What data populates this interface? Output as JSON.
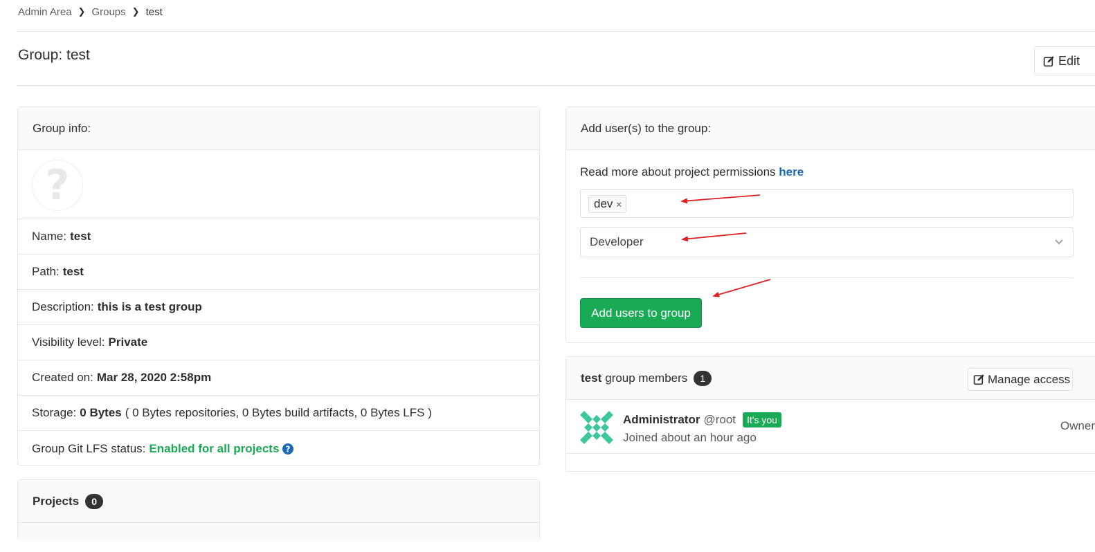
{
  "breadcrumb": {
    "items": [
      "Admin Area",
      "Groups"
    ],
    "current": "test"
  },
  "page": {
    "title": "Group: test",
    "edit_label": "Edit"
  },
  "group_info": {
    "header": "Group info:",
    "rows": [
      {
        "label": "Name:",
        "value": "test"
      },
      {
        "label": "Path:",
        "value": "test"
      },
      {
        "label": "Description:",
        "value": "this is a test group"
      },
      {
        "label": "Visibility level:",
        "value": "Private"
      },
      {
        "label": "Created on:",
        "value": "Mar 28, 2020 2:58pm"
      }
    ],
    "storage": {
      "label": "Storage:",
      "value": "0 Bytes",
      "detail": "( 0 Bytes repositories, 0 Bytes build artifacts, 0 Bytes LFS )"
    },
    "lfs": {
      "label": "Group Git LFS status:",
      "value": "Enabled for all projects"
    }
  },
  "projects": {
    "label": "Projects",
    "count": "0"
  },
  "add_users": {
    "header": "Add user(s) to the group:",
    "permissions_text": "Read more about project permissions",
    "permissions_link": "here",
    "token": "dev",
    "token_remove": "×",
    "role_selected": "Developer",
    "submit_label": "Add users to group"
  },
  "members": {
    "group_name": "test",
    "title_suffix": "group members",
    "count": "1",
    "manage_label": "Manage access",
    "list": [
      {
        "name": "Administrator",
        "username": "@root",
        "badge": "It's you",
        "joined": "Joined about an hour ago",
        "role": "Owner"
      }
    ]
  },
  "colors": {
    "green": "#1aaa55",
    "link_blue": "#1b69b6",
    "annotation_red": "#e02020"
  },
  "icons": {
    "edit": "edit-icon",
    "chevron": "chevron-down-icon",
    "help": "question-circle-icon"
  }
}
